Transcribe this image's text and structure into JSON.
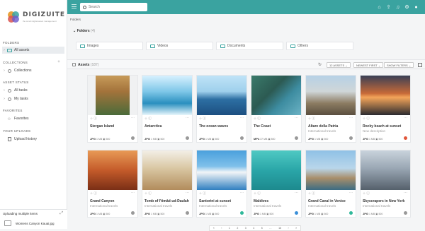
{
  "brand": {
    "name": "DIGIZUITE",
    "tagline": "the smart digital asset management"
  },
  "sidebar": {
    "sections": {
      "folders": "FOLDERS",
      "collections": "COLLECTIONS",
      "asset_status": "ASSET STATUS",
      "favorites": "FAVORITES",
      "your_uploads": "YOUR UPLOADS"
    },
    "items": {
      "all_assets": "All assets",
      "collections": "Collections",
      "all_tasks": "All tasks",
      "my_tasks": "My tasks",
      "favorites": "Favorites",
      "upload_history": "Upload history"
    }
  },
  "upload": {
    "title": "Uploading multiple items",
    "file": "Womens Canyon Kauai.jpg"
  },
  "search": {
    "placeholder": "Search"
  },
  "breadcrumb": "Folders",
  "folders": {
    "label": "Folders",
    "count": "(4)",
    "items": [
      "Images",
      "Videos",
      "Documents",
      "Others"
    ]
  },
  "assets": {
    "label": "Assets",
    "count": "(187)"
  },
  "toolbar": {
    "assets_per_page": "12 ASSETS",
    "sort": "NEWEST FIRST",
    "filters": "SHOW FILTERS"
  },
  "colors": {
    "accent": "#3aa3a0"
  },
  "cards": [
    {
      "title": "Siergao Island",
      "sub": "",
      "type": "JPG",
      "size": "1 MB",
      "dims": "500",
      "dot": "#999999"
    },
    {
      "title": "Antarctica",
      "sub": "",
      "type": "JPG",
      "size": "1 MB",
      "dims": "500",
      "dot": "#999999"
    },
    {
      "title": "The ocean waves",
      "sub": "",
      "type": "JPG",
      "size": "1 MB",
      "dims": "500",
      "dot": "#999999"
    },
    {
      "title": "The Coast",
      "sub": "",
      "type": "MP4",
      "size": "37 MB",
      "dims": "800",
      "dot": "#999999"
    },
    {
      "title": "Altare della Patria",
      "sub": "International travels",
      "type": "JPG",
      "size": "1 MB",
      "dims": "500",
      "dot": "#999999"
    },
    {
      "title": "Rocky beach at sunset",
      "sub": "New description",
      "type": "JPG",
      "size": "1 MB",
      "dims": "500",
      "dot": "#e0553a"
    },
    {
      "title": "Grand Canyon",
      "sub": "International travels",
      "type": "JPG",
      "size": "1 MB",
      "dims": "500",
      "dot": "#999999"
    },
    {
      "title": "Tomb of I'timād-ud-Daulah",
      "sub": "International travels",
      "type": "JPG",
      "size": "1 MB",
      "dims": "500",
      "dot": "#999999"
    },
    {
      "title": "Santorini at sunset",
      "sub": "International travels",
      "type": "JPG",
      "size": "1 MB",
      "dims": "500",
      "dot": "#2fb89a"
    },
    {
      "title": "Maldives",
      "sub": "International travels",
      "type": "JPG",
      "size": "1 MB",
      "dims": "500",
      "dot": "#3a8fd8"
    },
    {
      "title": "Grand Canal in Venice",
      "sub": "International travels",
      "type": "JPG",
      "size": "1 MB",
      "dims": "500",
      "dot": "#2fb89a"
    },
    {
      "title": "Skyscrapers in New York",
      "sub": "International travels",
      "type": "JPG",
      "size": "1 MB",
      "dims": "500",
      "dot": "#999999"
    }
  ]
}
